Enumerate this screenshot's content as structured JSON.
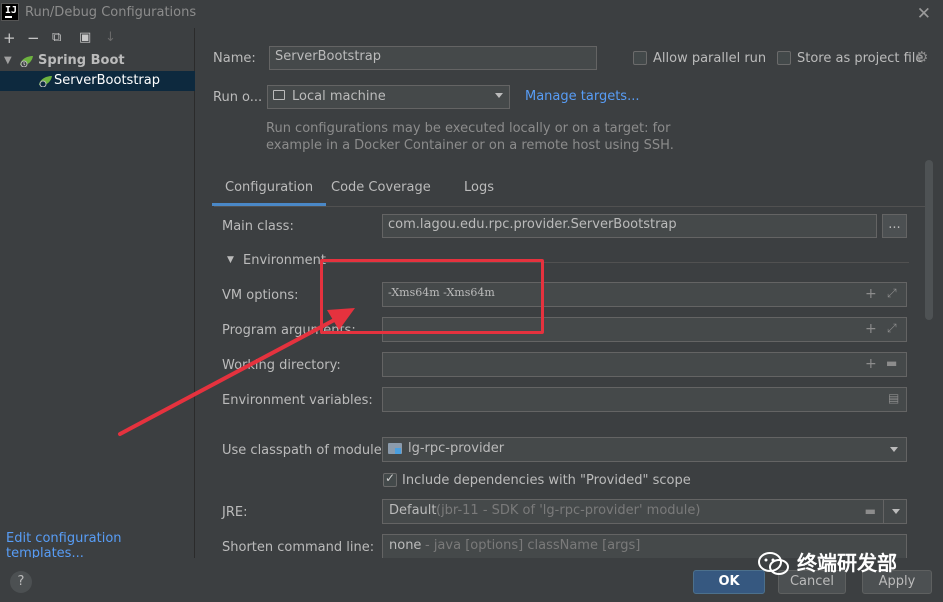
{
  "window": {
    "title": "Run/Debug Configurations"
  },
  "toolbar": {
    "add": "+",
    "remove": "−",
    "copy": "⧉",
    "folder": "▣",
    "sort": "↓"
  },
  "tree": {
    "group_label": "Spring Boot",
    "item_label": "ServerBootstrap"
  },
  "left_panel": {
    "edit_templates": "Edit configuration templates..."
  },
  "form": {
    "name_label": "Name:",
    "name_value": "ServerBootstrap",
    "allow_parallel": "Allow parallel run",
    "store_as_file": "Store as project file",
    "run_on_label": "Run o...",
    "run_on_value": "Local machine",
    "manage_targets": "Manage targets...",
    "hint_line1": "Run configurations may be executed locally or on a target: for",
    "hint_line2": "example in a Docker Container or on a remote host using SSH."
  },
  "tabs": [
    "Configuration",
    "Code Coverage",
    "Logs"
  ],
  "config": {
    "main_class_label": "Main class:",
    "main_class_value": "com.lagou.edu.rpc.provider.ServerBootstrap",
    "browse": "...",
    "environment_label": "Environment",
    "vm_options_label": "VM options:",
    "vm_options_value": "-Xms64m -Xms64m",
    "program_args_label": "Program arguments:",
    "working_dir_label": "Working directory:",
    "env_vars_label": "Environment variables:",
    "classpath_label": "Use classpath of module:",
    "classpath_value": "lg-rpc-provider",
    "include_deps": "Include dependencies with \"Provided\" scope",
    "jre_label": "JRE:",
    "jre_value": "Default",
    "jre_detail": "(jbr-11 - SDK of 'lg-rpc-provider' module)",
    "shorten_label": "Shorten command line:",
    "shorten_value": "none",
    "shorten_detail": "- java [options] className [args]"
  },
  "buttons": {
    "help": "?",
    "ok": "OK",
    "cancel": "Cancel",
    "apply": "Apply"
  },
  "watermark": {
    "text": "终端研发部"
  },
  "colors": {
    "accent": "#365880",
    "link": "#589df6",
    "annotation": "#e5323e",
    "selection": "#0d293e"
  }
}
